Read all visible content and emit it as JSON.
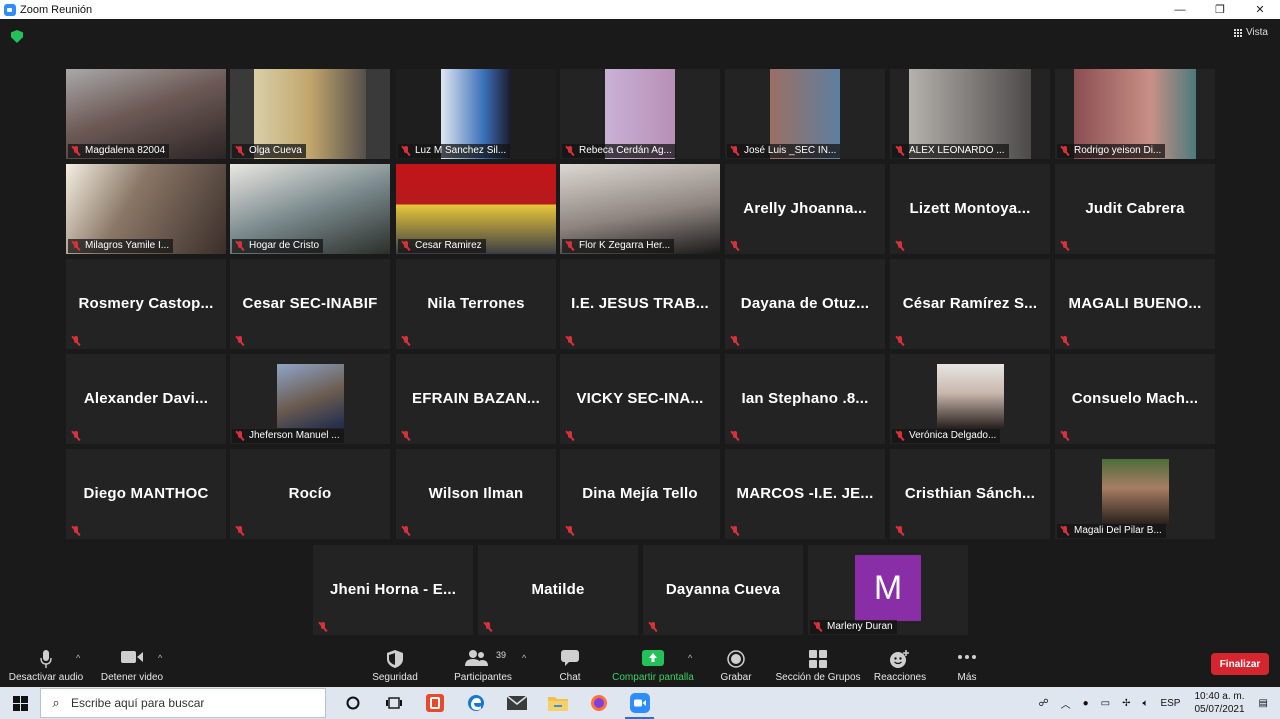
{
  "window": {
    "title": "Zoom Reunión",
    "controls": [
      "—",
      "❐",
      "✕"
    ]
  },
  "view_button": "Vista",
  "tiles": [
    {
      "name": "Magdalena 82004",
      "type": "video"
    },
    {
      "name": "Olga Cueva",
      "type": "video",
      "active": true
    },
    {
      "name": "Luz M Sanchez Sil...",
      "type": "video"
    },
    {
      "name": "Rebeca Cerdán Ag...",
      "type": "video"
    },
    {
      "name": "José Luis _SEC IN...",
      "type": "video"
    },
    {
      "name": "ALEX LEONARDO ...",
      "type": "video"
    },
    {
      "name": "Rodrigo yeison Di...",
      "type": "video"
    },
    {
      "name": "Milagros Yamile I...",
      "type": "video"
    },
    {
      "name": "Hogar de Cristo",
      "type": "video"
    },
    {
      "name": "Cesar Ramirez",
      "type": "video"
    },
    {
      "name": "Flor K Zegarra Her...",
      "type": "video"
    },
    {
      "name": "Arelly  Jhoanna...",
      "type": "name"
    },
    {
      "name": "Lizett  Montoya...",
      "type": "name"
    },
    {
      "name": "Judit Cabrera",
      "type": "name"
    },
    {
      "name": "Rosmery  Castop...",
      "type": "name"
    },
    {
      "name": "Cesar SEC-INABIF",
      "type": "name"
    },
    {
      "name": "Nila Terrones",
      "type": "name"
    },
    {
      "name": "I.E. JESUS  TRAB...",
      "type": "name"
    },
    {
      "name": "Dayana de Otuz...",
      "type": "name"
    },
    {
      "name": "César  Ramírez S...",
      "type": "name"
    },
    {
      "name": "MAGALI  BUENO...",
      "type": "name"
    },
    {
      "name": "Alexander  Davi...",
      "type": "name"
    },
    {
      "name": "Jheferson Manuel ...",
      "type": "photo"
    },
    {
      "name": "EFRAIN  BAZAN...",
      "type": "name"
    },
    {
      "name": "VICKY  SEC-INA...",
      "type": "name"
    },
    {
      "name": "Ian Stephano .8...",
      "type": "name"
    },
    {
      "name": "Verónica Delgado...",
      "type": "photo"
    },
    {
      "name": "Consuelo  Mach...",
      "type": "name"
    },
    {
      "name": "Diego MANTHOC",
      "type": "name"
    },
    {
      "name": "Rocío",
      "type": "name"
    },
    {
      "name": "Wilson Ilman",
      "type": "name"
    },
    {
      "name": "Dina Mejía Tello",
      "type": "name"
    },
    {
      "name": "MARCOS  -I.E. JE...",
      "type": "name"
    },
    {
      "name": "Cristhian  Sánch...",
      "type": "name"
    },
    {
      "name": "Magali Del Pilar B...",
      "type": "photo"
    },
    {
      "name": "Jheni  Horna - E...",
      "type": "name"
    },
    {
      "name": "Matilde",
      "type": "name"
    },
    {
      "name": "Dayanna Cueva",
      "type": "name"
    },
    {
      "name": "Marleny Duran",
      "type": "avatar",
      "initial": "M"
    }
  ],
  "toolbar": {
    "mute_audio": "Desactivar audio",
    "stop_video": "Detener video",
    "security": "Seguridad",
    "participants": "Participantes",
    "participants_count": "39",
    "chat": "Chat",
    "share_screen": "Compartir pantalla",
    "record": "Grabar",
    "breakout_rooms": "Sección de Grupos",
    "reactions": "Reacciones",
    "more": "Más",
    "end": "Finalizar"
  },
  "taskbar": {
    "search_placeholder": "Escribe aquí para buscar",
    "language": "ESP",
    "time": "10:40 a. m.",
    "date": "05/07/2021"
  },
  "colors": {
    "accent_active_speaker": "#b8d24a",
    "share_green": "#39d163",
    "end_red": "#d5262f",
    "mute_red": "#d8313a",
    "avatar_purple": "#8a2ea8"
  }
}
